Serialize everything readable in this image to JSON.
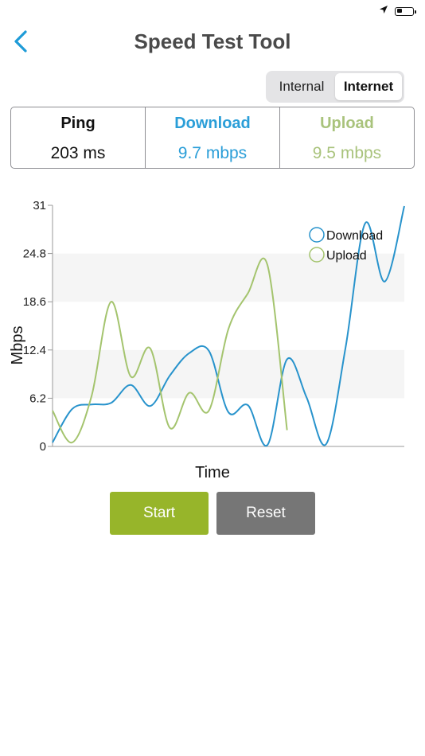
{
  "status_bar": {
    "location_icon": "location-arrow-icon",
    "battery_icon": "battery-low-icon"
  },
  "nav": {
    "back_icon": "chevron-left-icon",
    "title": "Speed Test Tool"
  },
  "segmented": {
    "options": [
      "Internal",
      "Internet"
    ],
    "selected": "Internet"
  },
  "stats": {
    "ping": {
      "label": "Ping",
      "value": "203 ms"
    },
    "download": {
      "label": "Download",
      "value": "9.7 mbps"
    },
    "upload": {
      "label": "Upload",
      "value": "9.5 mbps"
    }
  },
  "colors": {
    "accent": "#1e9bd7",
    "download": "#2893cc",
    "upload": "#a4c46e",
    "start_button": "#97b52a",
    "reset_button": "#767676",
    "ping_text": "#111111"
  },
  "buttons": {
    "start": "Start",
    "reset": "Reset"
  },
  "chart_data": {
    "type": "line",
    "title": "",
    "xlabel": "Time",
    "ylabel": "Mbps",
    "ylim": [
      0,
      31
    ],
    "yticks": [
      "0",
      "6.2",
      "12.4",
      "18.6",
      "24.8",
      "31"
    ],
    "grid": "alternating horizontal bands",
    "legend_position": "top-right",
    "series": [
      {
        "name": "Download",
        "color": "#2893cc",
        "x": [
          0,
          1,
          2,
          3,
          4,
          5,
          6,
          7,
          8,
          9,
          10,
          11,
          12,
          13,
          14,
          15,
          16,
          17,
          18
        ],
        "values": [
          0.5,
          4.8,
          5.4,
          5.6,
          7.9,
          5.2,
          9.1,
          12.0,
          12.3,
          4.4,
          5.3,
          0.2,
          11.2,
          6.3,
          0.3,
          12.8,
          28.7,
          21.2,
          30.9
        ]
      },
      {
        "name": "Upload",
        "color": "#a4c46e",
        "x": [
          0,
          1,
          2,
          3,
          4,
          5,
          6,
          7,
          8,
          9,
          10,
          11,
          12
        ],
        "values": [
          4.6,
          0.5,
          6.5,
          18.6,
          9.0,
          12.6,
          2.4,
          6.9,
          4.6,
          15.1,
          19.7,
          23.3,
          2.1
        ]
      }
    ]
  }
}
